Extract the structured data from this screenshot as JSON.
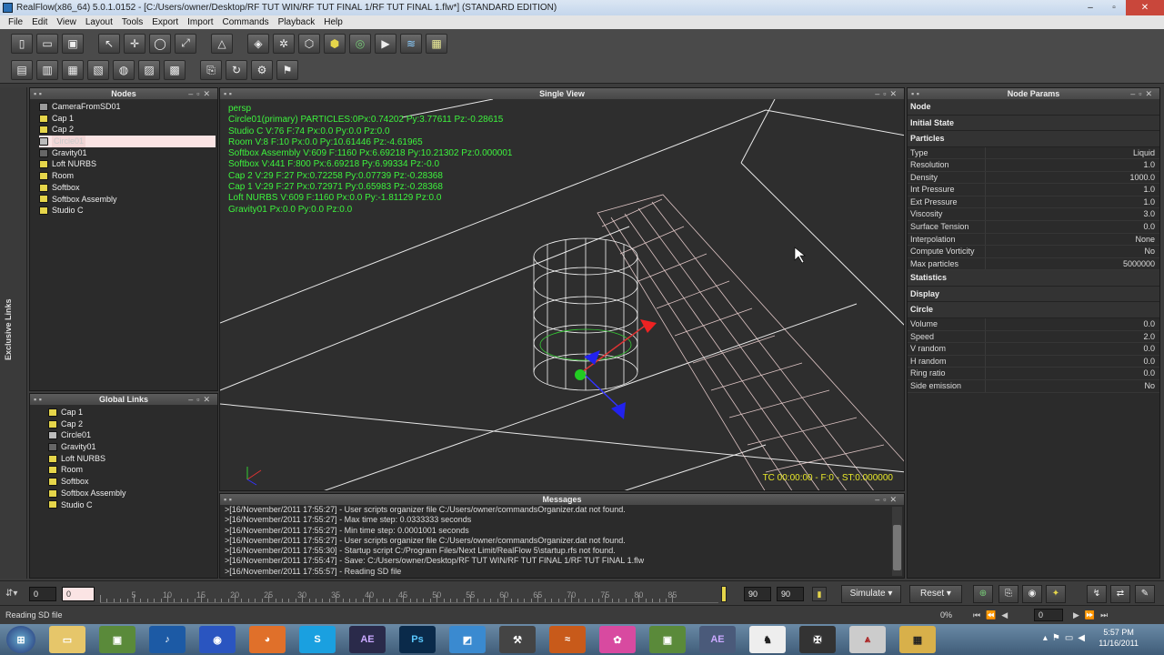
{
  "window": {
    "title": "RealFlow(x86_64) 5.0.1.0152 - [C:/Users/owner/Desktop/RF TUT WIN/RF TUT FINAL 1/RF TUT FINAL 1.flw*] (STANDARD EDITION)"
  },
  "menu": [
    "File",
    "Edit",
    "View",
    "Layout",
    "Tools",
    "Export",
    "Import",
    "Commands",
    "Playback",
    "Help"
  ],
  "left_strip": {
    "label": "Exclusive Links"
  },
  "nodes_panel": {
    "title": "Nodes",
    "items": [
      {
        "label": "CameraFromSD01",
        "icon": "camera-icon"
      },
      {
        "label": "Cap 1",
        "icon": "object-icon"
      },
      {
        "label": "Cap 2",
        "icon": "object-icon"
      },
      {
        "label": "Circle01",
        "icon": "emitter-icon",
        "selected": true
      },
      {
        "label": "Gravity01",
        "icon": "daemon-icon"
      },
      {
        "label": "Loft NURBS",
        "icon": "object-icon"
      },
      {
        "label": "Room",
        "icon": "object-icon"
      },
      {
        "label": "Softbox",
        "icon": "object-icon"
      },
      {
        "label": "Softbox Assembly",
        "icon": "object-icon"
      },
      {
        "label": "Studio C",
        "icon": "object-icon"
      }
    ]
  },
  "global_links": {
    "title": "Global Links",
    "items": [
      {
        "label": "Cap 1",
        "icon": "object-icon"
      },
      {
        "label": "Cap 2",
        "icon": "object-icon"
      },
      {
        "label": "Circle01",
        "icon": "emitter-icon"
      },
      {
        "label": "Gravity01",
        "icon": "daemon-icon"
      },
      {
        "label": "Loft NURBS",
        "icon": "object-icon"
      },
      {
        "label": "Room",
        "icon": "object-icon"
      },
      {
        "label": "Softbox",
        "icon": "object-icon"
      },
      {
        "label": "Softbox Assembly",
        "icon": "object-icon"
      },
      {
        "label": "Studio C",
        "icon": "object-icon"
      }
    ]
  },
  "viewport": {
    "title": "Single View",
    "hud": [
      "persp",
      "Circle01(primary) PARTICLES:0Px:0.74202 Py:3.77611 Pz:-0.28615",
      "Studio C V:76 F:74 Px:0.0 Py:0.0 Pz:0.0",
      "Room V:8 F:10 Px:0.0 Py:10.61446 Pz:-4.61965",
      "Softbox Assembly V:609 F:1160 Px:6.69218 Py:10.21302 Pz:0.000001",
      "Softbox V:441 F:800 Px:6.69218 Py:6.99334 Pz:-0.0",
      "Cap 2 V:29 F:27 Px:0.72258 Py:0.07739 Pz:-0.28368",
      "Cap 1 V:29 F:27 Px:0.72971 Py:0.65983 Pz:-0.28368",
      "Loft NURBS V:609 F:1160 Px:0.0 Py:-1.81129 Pz:0.0",
      "Gravity01 Px:0.0 Py:0.0 Pz:0.0"
    ],
    "tc": "TC 00:00:00 - F:0 - ST:0.000000"
  },
  "node_params": {
    "title": "Node Params",
    "sections_top": [
      "Node",
      "Initial State",
      "Particles"
    ],
    "particles": [
      {
        "k": "Type",
        "v": "Liquid"
      },
      {
        "k": "Resolution",
        "v": "1.0"
      },
      {
        "k": "Density",
        "v": "1000.0"
      },
      {
        "k": "Int Pressure",
        "v": "1.0"
      },
      {
        "k": "Ext Pressure",
        "v": "1.0"
      },
      {
        "k": "Viscosity",
        "v": "3.0"
      },
      {
        "k": "Surface Tension",
        "v": "0.0"
      },
      {
        "k": "Interpolation",
        "v": "None"
      },
      {
        "k": "Compute Vorticity",
        "v": "No"
      },
      {
        "k": "Max particles",
        "v": "5000000"
      }
    ],
    "sections_mid": [
      "Statistics",
      "Display",
      "Circle"
    ],
    "circle": [
      {
        "k": "Volume",
        "v": "0.0"
      },
      {
        "k": "Speed",
        "v": "2.0"
      },
      {
        "k": "V random",
        "v": "0.0"
      },
      {
        "k": "H random",
        "v": "0.0"
      },
      {
        "k": "Ring ratio",
        "v": "0.0"
      },
      {
        "k": "Side emission",
        "v": "No"
      }
    ]
  },
  "messages": {
    "title": "Messages",
    "lines": [
      ">[16/November/2011 17:55:27] - User scripts organizer file C:/Users/owner/commandsOrganizer.dat not found.",
      ">[16/November/2011 17:55:27] - Max time step: 0.0333333 seconds",
      ">[16/November/2011 17:55:27] - Min time step: 0.0001001 seconds",
      ">[16/November/2011 17:55:27] - User scripts organizer file C:/Users/owner/commandsOrganizer.dat not found.",
      ">[16/November/2011 17:55:30] - Startup script C:/Program Files/Next Limit/RealFlow 5\\startup.rfs not found.",
      ">[16/November/2011 17:55:47] - Save: C:/Users/owner/Desktop/RF TUT WIN/RF TUT FINAL 1/RF TUT FINAL 1.flw",
      ">[16/November/2011 17:55:57] - Reading SD file"
    ]
  },
  "timeline": {
    "start": "0",
    "current": "0",
    "ticks": [
      "5",
      "10",
      "15",
      "20",
      "25",
      "30",
      "35",
      "40",
      "45",
      "50",
      "55",
      "60",
      "65",
      "70",
      "75",
      "80",
      "85"
    ],
    "end1": "90",
    "end2": "90",
    "simulate": "Simulate",
    "reset": "Reset",
    "frame": "0"
  },
  "status": {
    "text": "Reading SD file",
    "percent": "0%"
  },
  "taskbar": {
    "apps": [
      "AE",
      "Ps",
      "AE"
    ],
    "time": "5:57 PM",
    "date": "11/16/2011"
  }
}
